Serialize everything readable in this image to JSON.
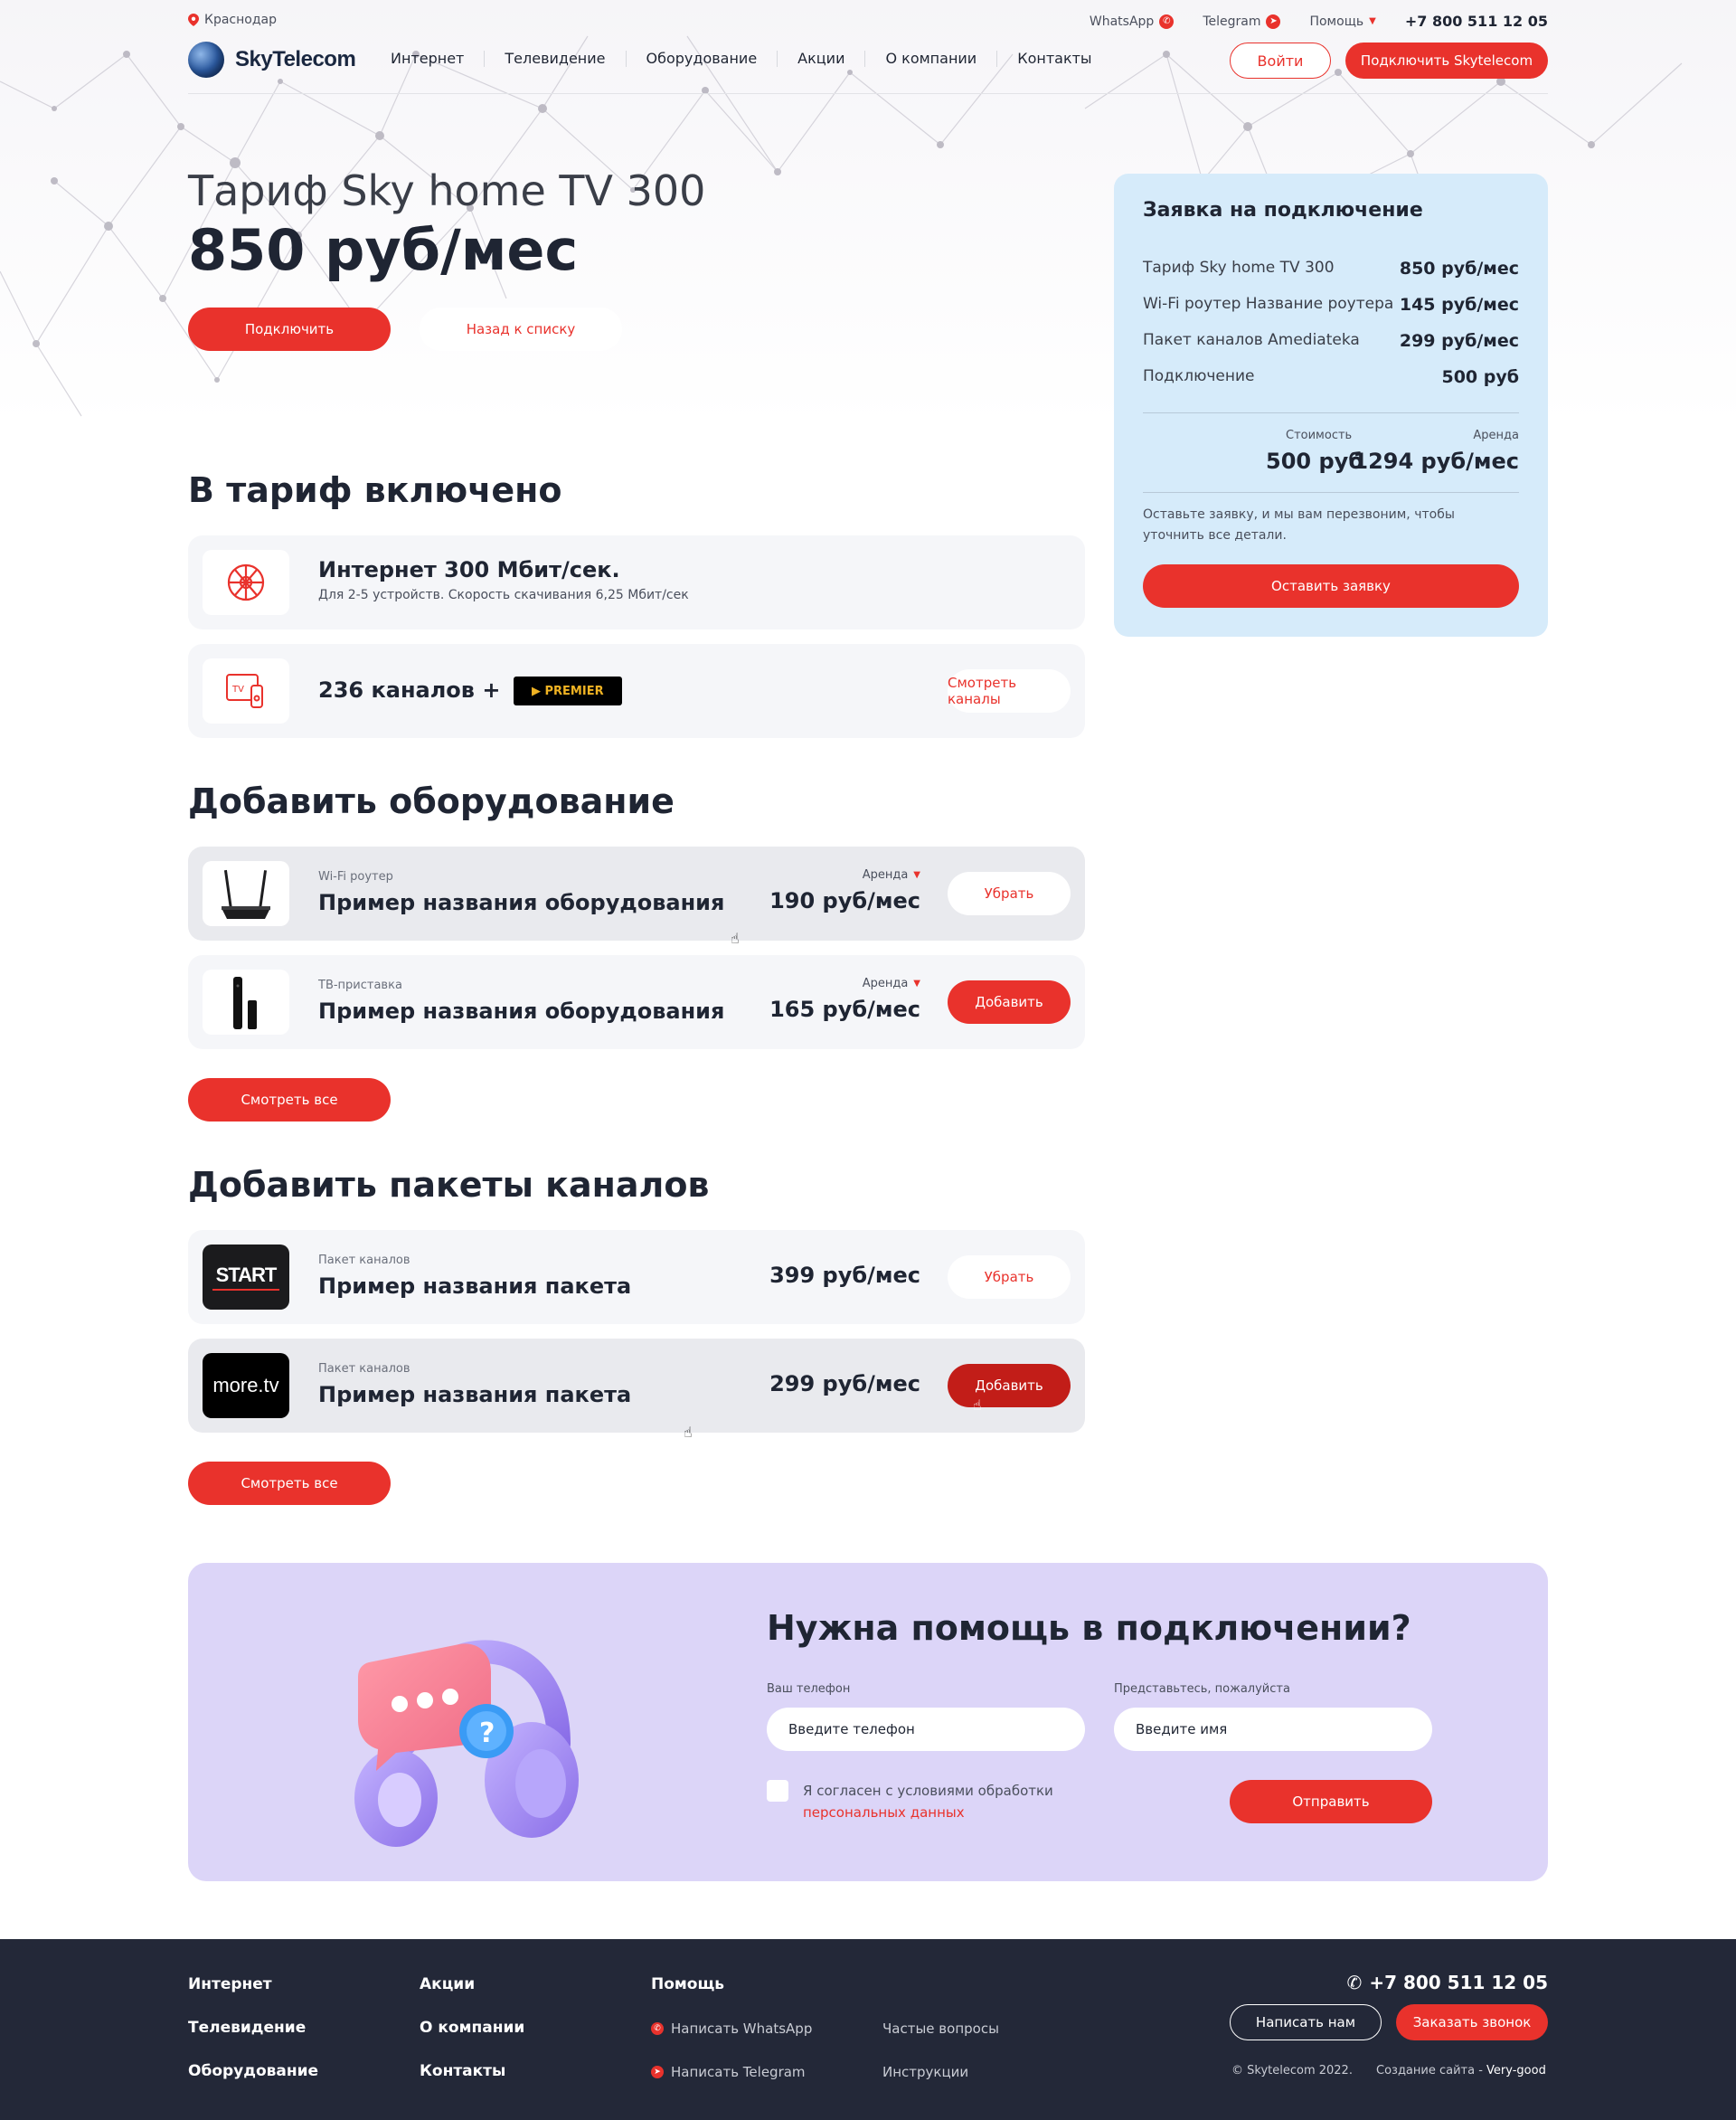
{
  "topbar": {
    "city": "Краснодар",
    "whatsapp": "WhatsApp",
    "telegram": "Telegram",
    "help": "Помощь",
    "phone": "+7 800 511 12 05"
  },
  "header": {
    "logo": "SkyTelecom",
    "nav": [
      "Интернет",
      "Телевидение",
      "Оборудование",
      "Акции",
      "О компании",
      "Контакты"
    ],
    "login": "Войти",
    "connect": "Подключить Skytelecom"
  },
  "hero": {
    "title": "Тариф Sky home TV 300",
    "price": "850 руб/мес",
    "connect_btn": "Подключить",
    "back_btn": "Назад к списку"
  },
  "included": {
    "heading": "В тариф включено",
    "internet_title": "Интернет 300 Мбит/сек.",
    "internet_sub": "Для 2-5 устройств. Скорость скачивания 6,25 Мбит/сек",
    "tv_title": "236 каналов +",
    "premier": "▶ PREMIER",
    "channels_btn": "Смотреть каналы"
  },
  "equipment": {
    "heading": "Добавить оборудование",
    "items": [
      {
        "type": "Wi-Fi роутер",
        "name": "Пример названия оборудования",
        "rent": "Аренда",
        "price": "190 руб/мес",
        "action": "Убрать"
      },
      {
        "type": "ТВ-приставка",
        "name": "Пример названия оборудования",
        "rent": "Аренда",
        "price": "165 руб/мес",
        "action": "Добавить"
      }
    ],
    "see_all": "Смотреть все"
  },
  "packages": {
    "heading": "Добавить пакеты каналов",
    "items": [
      {
        "logo": "START",
        "type": "Пакет каналов",
        "name": "Пример названия пакета",
        "price": "399 руб/мес",
        "action": "Убрать"
      },
      {
        "logo": "more.tv",
        "type": "Пакет каналов",
        "name": "Пример названия пакета",
        "price": "299 руб/мес",
        "action": "Добавить"
      }
    ],
    "see_all": "Смотреть все"
  },
  "order": {
    "title": "Заявка на подключение",
    "rows": [
      {
        "label": "Тариф Sky home TV 300",
        "value": "850 руб/мес"
      },
      {
        "label": "Wi-Fi роутер Название роутера",
        "value": "145 руб/мес"
      },
      {
        "label": "Пакет каналов Amediateka",
        "value": "299 руб/мес"
      },
      {
        "label": "Подключение",
        "value": "500 руб"
      }
    ],
    "cost_label": "Стоимость",
    "cost_value": "500 руб",
    "rent_label": "Аренда",
    "rent_value": "1294 руб/мес",
    "note": "Оставьте заявку, и мы вам перезвоним, чтобы уточнить все детали.",
    "submit": "Оставить заявку"
  },
  "help": {
    "title": "Нужна помощь в подключении?",
    "phone_label": "Ваш телефон",
    "phone_placeholder": "Введите телефон",
    "name_label": "Представьтесь, пожалуйста",
    "name_placeholder": "Введите имя",
    "consent": "Я согласен с условиями обработки",
    "consent_link": "персональных данных",
    "submit": "Отправить"
  },
  "footer": {
    "col1": [
      "Интернет",
      "Телевидение",
      "Оборудование"
    ],
    "col2": [
      "Акции",
      "О компании",
      "Контакты"
    ],
    "help_head": "Помощь",
    "write_whatsapp": "Написать WhatsApp",
    "write_telegram": "Написать Telegram",
    "faq": "Частые вопросы",
    "instructions": "Инструкции",
    "phone": "+7 800 511 12 05",
    "write_us": "Написать нам",
    "callback": "Заказать звонок",
    "copyright": "© Skytelecom 2022.",
    "created": "Создание сайта -",
    "creator": "Very-good"
  },
  "colors": {
    "accent": "#e9322c",
    "order_bg": "#d6ebfa",
    "help_bg": "#dcd5f8",
    "footer_bg": "#232838"
  }
}
